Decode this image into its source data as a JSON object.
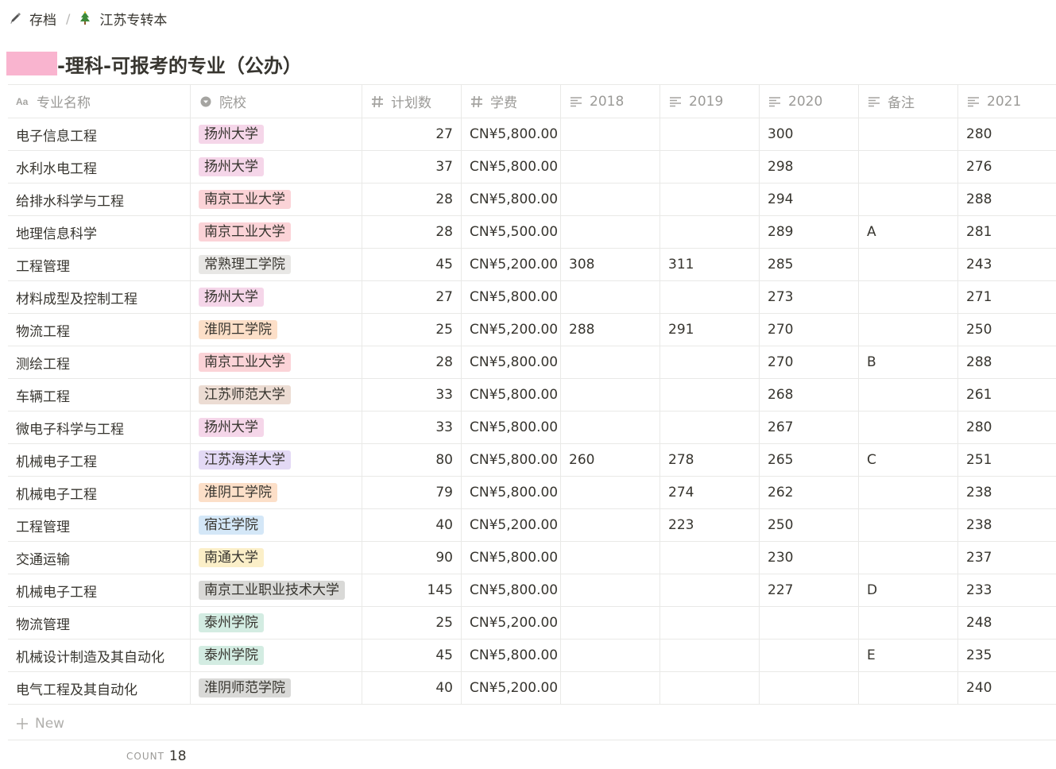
{
  "breadcrumb": {
    "items": [
      {
        "label": "存档",
        "icon": "pencil-icon"
      },
      {
        "label": "江苏专转本",
        "icon": "tree-icon"
      }
    ],
    "separator": "/"
  },
  "page": {
    "title": "-理科-可报考的专业（公办）",
    "redaction_color": "#f9b4cf"
  },
  "table": {
    "columns": [
      {
        "label": "专业名称",
        "icon": "text-type-icon"
      },
      {
        "label": "院校",
        "icon": "select-icon"
      },
      {
        "label": "计划数",
        "icon": "number-icon"
      },
      {
        "label": "学费",
        "icon": "number-icon"
      },
      {
        "label": "2018",
        "icon": "text-lines-icon"
      },
      {
        "label": "2019",
        "icon": "text-lines-icon"
      },
      {
        "label": "2020",
        "icon": "text-lines-icon"
      },
      {
        "label": "备注",
        "icon": "text-lines-icon"
      },
      {
        "label": "2021",
        "icon": "text-lines-icon"
      }
    ],
    "rows": [
      {
        "name": "电子信息工程",
        "school": "扬州大学",
        "tag_color": "#f5d6e9",
        "plan": "27",
        "fee": "CN¥5,800.00",
        "y2018": "",
        "y2019": "",
        "y2020": "300",
        "note": "",
        "y2021": "280"
      },
      {
        "name": "水利水电工程",
        "school": "扬州大学",
        "tag_color": "#f5d6e9",
        "plan": "37",
        "fee": "CN¥5,800.00",
        "y2018": "",
        "y2019": "",
        "y2020": "298",
        "note": "",
        "y2021": "276"
      },
      {
        "name": "给排水科学与工程",
        "school": "南京工业大学",
        "tag_color": "#fbd3d7",
        "plan": "28",
        "fee": "CN¥5,800.00",
        "y2018": "",
        "y2019": "",
        "y2020": "294",
        "note": "",
        "y2021": "288"
      },
      {
        "name": "地理信息科学",
        "school": "南京工业大学",
        "tag_color": "#fbd3d7",
        "plan": "28",
        "fee": "CN¥5,500.00",
        "y2018": "",
        "y2019": "",
        "y2020": "289",
        "note": "A",
        "y2021": "281"
      },
      {
        "name": "工程管理",
        "school": "常熟理工学院",
        "tag_color": "#e8e7e5",
        "plan": "45",
        "fee": "CN¥5,200.00",
        "y2018": "308",
        "y2019": "311",
        "y2020": "285",
        "note": "",
        "y2021": "243"
      },
      {
        "name": "材料成型及控制工程",
        "school": "扬州大学",
        "tag_color": "#f5d6e9",
        "plan": "27",
        "fee": "CN¥5,800.00",
        "y2018": "",
        "y2019": "",
        "y2020": "273",
        "note": "",
        "y2021": "271"
      },
      {
        "name": "物流工程",
        "school": "淮阴工学院",
        "tag_color": "#fcdfc8",
        "plan": "25",
        "fee": "CN¥5,200.00",
        "y2018": "288",
        "y2019": "291",
        "y2020": "270",
        "note": "",
        "y2021": "250"
      },
      {
        "name": "测绘工程",
        "school": "南京工业大学",
        "tag_color": "#fbd3d7",
        "plan": "28",
        "fee": "CN¥5,800.00",
        "y2018": "",
        "y2019": "",
        "y2020": "270",
        "note": "B",
        "y2021": "288"
      },
      {
        "name": "车辆工程",
        "school": "江苏师范大学",
        "tag_color": "#ecdcd3",
        "plan": "33",
        "fee": "CN¥5,800.00",
        "y2018": "",
        "y2019": "",
        "y2020": "268",
        "note": "",
        "y2021": "261"
      },
      {
        "name": "微电子科学与工程",
        "school": "扬州大学",
        "tag_color": "#f5d6e9",
        "plan": "33",
        "fee": "CN¥5,800.00",
        "y2018": "",
        "y2019": "",
        "y2020": "267",
        "note": "",
        "y2021": "280"
      },
      {
        "name": "机械电子工程",
        "school": "江苏海洋大学",
        "tag_color": "#e3d9f5",
        "plan": "80",
        "fee": "CN¥5,800.00",
        "y2018": "260",
        "y2019": "278",
        "y2020": "265",
        "note": "C",
        "y2021": "251"
      },
      {
        "name": "机械电子工程",
        "school": "淮阴工学院",
        "tag_color": "#fcdfc8",
        "plan": "79",
        "fee": "CN¥5,800.00",
        "y2018": "",
        "y2019": "274",
        "y2020": "262",
        "note": "",
        "y2021": "238"
      },
      {
        "name": "工程管理",
        "school": "宿迁学院",
        "tag_color": "#d4e7f7",
        "plan": "40",
        "fee": "CN¥5,200.00",
        "y2018": "",
        "y2019": "223",
        "y2020": "250",
        "note": "",
        "y2021": "238"
      },
      {
        "name": "交通运输",
        "school": "南通大学",
        "tag_color": "#fbefc8",
        "plan": "90",
        "fee": "CN¥5,800.00",
        "y2018": "",
        "y2019": "",
        "y2020": "230",
        "note": "",
        "y2021": "237"
      },
      {
        "name": "机械电子工程",
        "school": "南京工业职业技术大学",
        "tag_color": "#d9d9d7",
        "plan": "145",
        "fee": "CN¥5,800.00",
        "y2018": "",
        "y2019": "",
        "y2020": "227",
        "note": "D",
        "y2021": "233"
      },
      {
        "name": "物流管理",
        "school": "泰州学院",
        "tag_color": "#d3ece2",
        "plan": "25",
        "fee": "CN¥5,200.00",
        "y2018": "",
        "y2019": "",
        "y2020": "",
        "note": "",
        "y2021": "248"
      },
      {
        "name": "机械设计制造及其自动化",
        "school": "泰州学院",
        "tag_color": "#d3ece2",
        "plan": "45",
        "fee": "CN¥5,800.00",
        "y2018": "",
        "y2019": "",
        "y2020": "",
        "note": "E",
        "y2021": "235"
      },
      {
        "name": "电气工程及其自动化",
        "school": "淮阴师范学院",
        "tag_color": "#d9d9d7",
        "plan": "40",
        "fee": "CN¥5,200.00",
        "y2018": "",
        "y2019": "",
        "y2020": "",
        "note": "",
        "y2021": "240"
      }
    ],
    "new_label": "New",
    "count_label": "COUNT",
    "count_value": "18"
  }
}
